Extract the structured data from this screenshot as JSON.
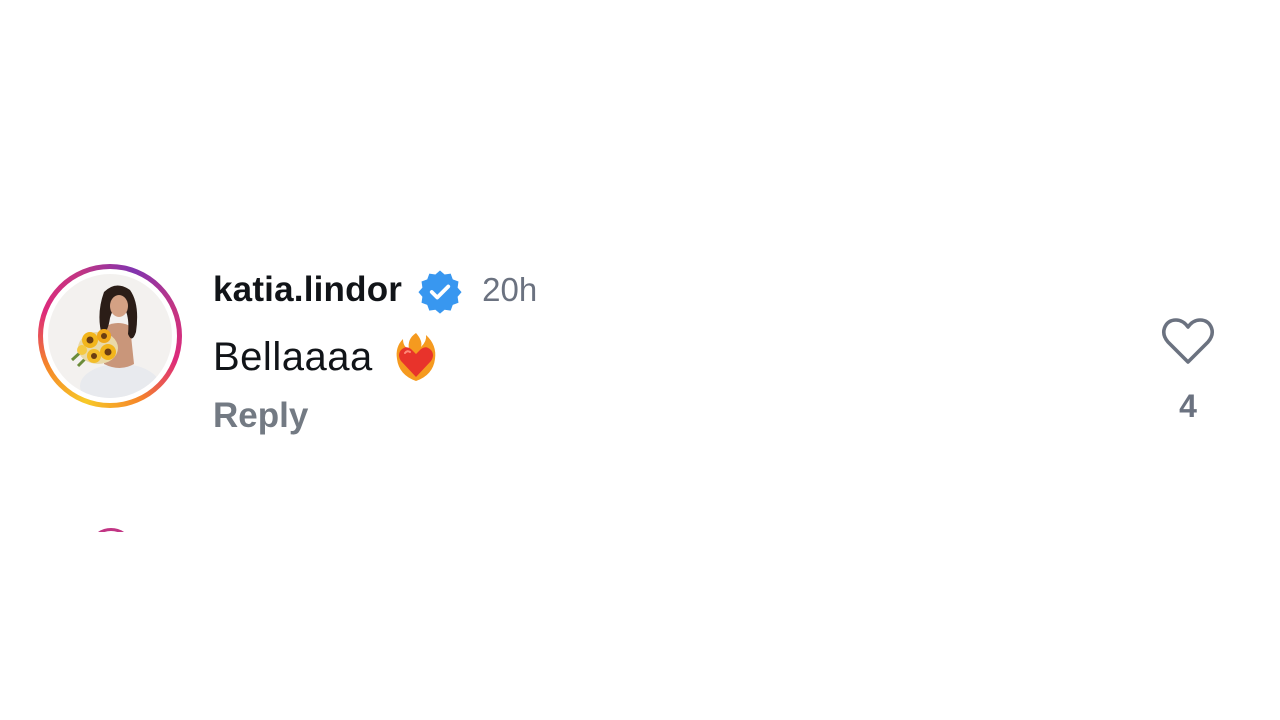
{
  "comment": {
    "username": "katia.lindor",
    "time": "20h",
    "text": "Bellaaaa",
    "emoji": "heart-on-fire",
    "reply_label": "Reply",
    "like_count": "4",
    "verified": true
  },
  "colors": {
    "verified_blue": "#3897f0",
    "secondary_text": "#737a83",
    "primary_text": "#111418"
  }
}
